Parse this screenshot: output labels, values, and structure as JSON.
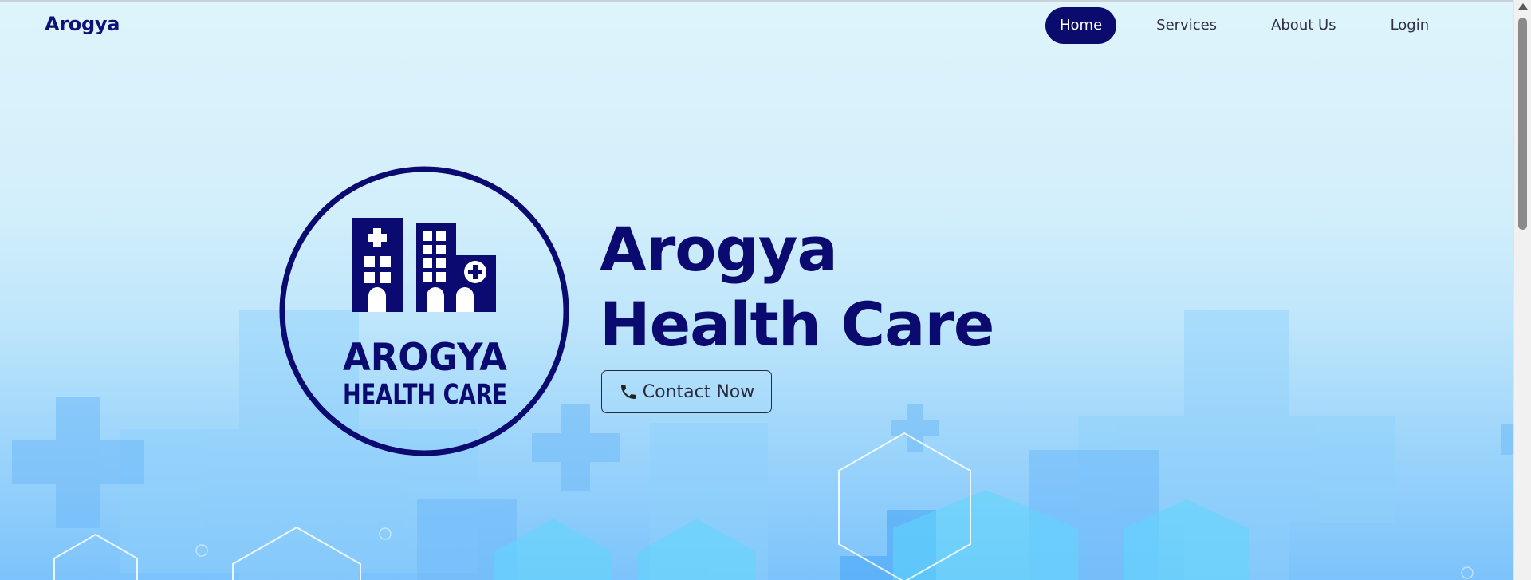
{
  "header": {
    "brand": "Arogya",
    "nav": [
      {
        "label": "Home",
        "active": true
      },
      {
        "label": "Services",
        "active": false
      },
      {
        "label": "About Us",
        "active": false
      },
      {
        "label": "Login",
        "active": false
      }
    ]
  },
  "hero": {
    "logo_text": [
      "AROGYA",
      "HEALTH CARE"
    ],
    "title_line1": "Arogya",
    "title_line2": "Health Care",
    "contact_label": "Contact Now",
    "contact_icon": "phone-icon"
  },
  "colors": {
    "brand": "#0a0a70",
    "nav_active_bg": "#0b0b6e",
    "background_top": "#dff4fb",
    "background_bottom": "#7cc3fb"
  }
}
